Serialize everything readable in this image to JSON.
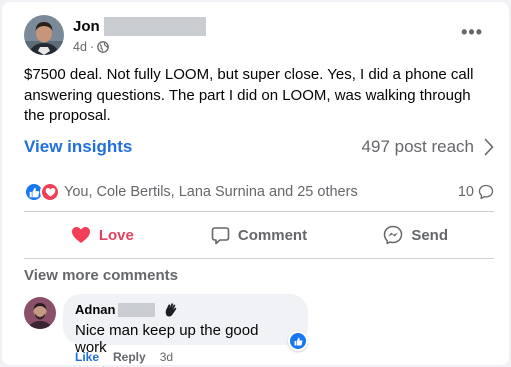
{
  "post": {
    "author_name": "Jon",
    "timestamp": "4d",
    "separator": "·",
    "privacy_icon": "public-globe-icon",
    "menu_label": "•••",
    "text": "$7500 deal.  Not fully LOOM, but super close. Yes, I did a phone call answering questions.  The part I did on LOOM, was walking through the proposal."
  },
  "insights": {
    "link_label": "View insights",
    "reach_label": "497 post reach"
  },
  "reactions": {
    "icons": [
      "like-icon",
      "love-icon"
    ],
    "summary": "You, Cole Bertils, Lana Surnina and 25 others",
    "comment_count": "10"
  },
  "actions": {
    "love_label": "Love",
    "comment_label": "Comment",
    "send_label": "Send"
  },
  "comments": {
    "view_more_label": "View more comments",
    "items": [
      {
        "author_name": "Adnan",
        "badge_icon": "waving-hand-icon",
        "text": "Nice man keep up the good work",
        "like_label": "Like",
        "reply_label": "Reply",
        "timestamp": "3d"
      }
    ]
  },
  "colors": {
    "accent_blue": "#216fdb",
    "love_red": "#e4405f",
    "secondary_text": "#65676b"
  }
}
